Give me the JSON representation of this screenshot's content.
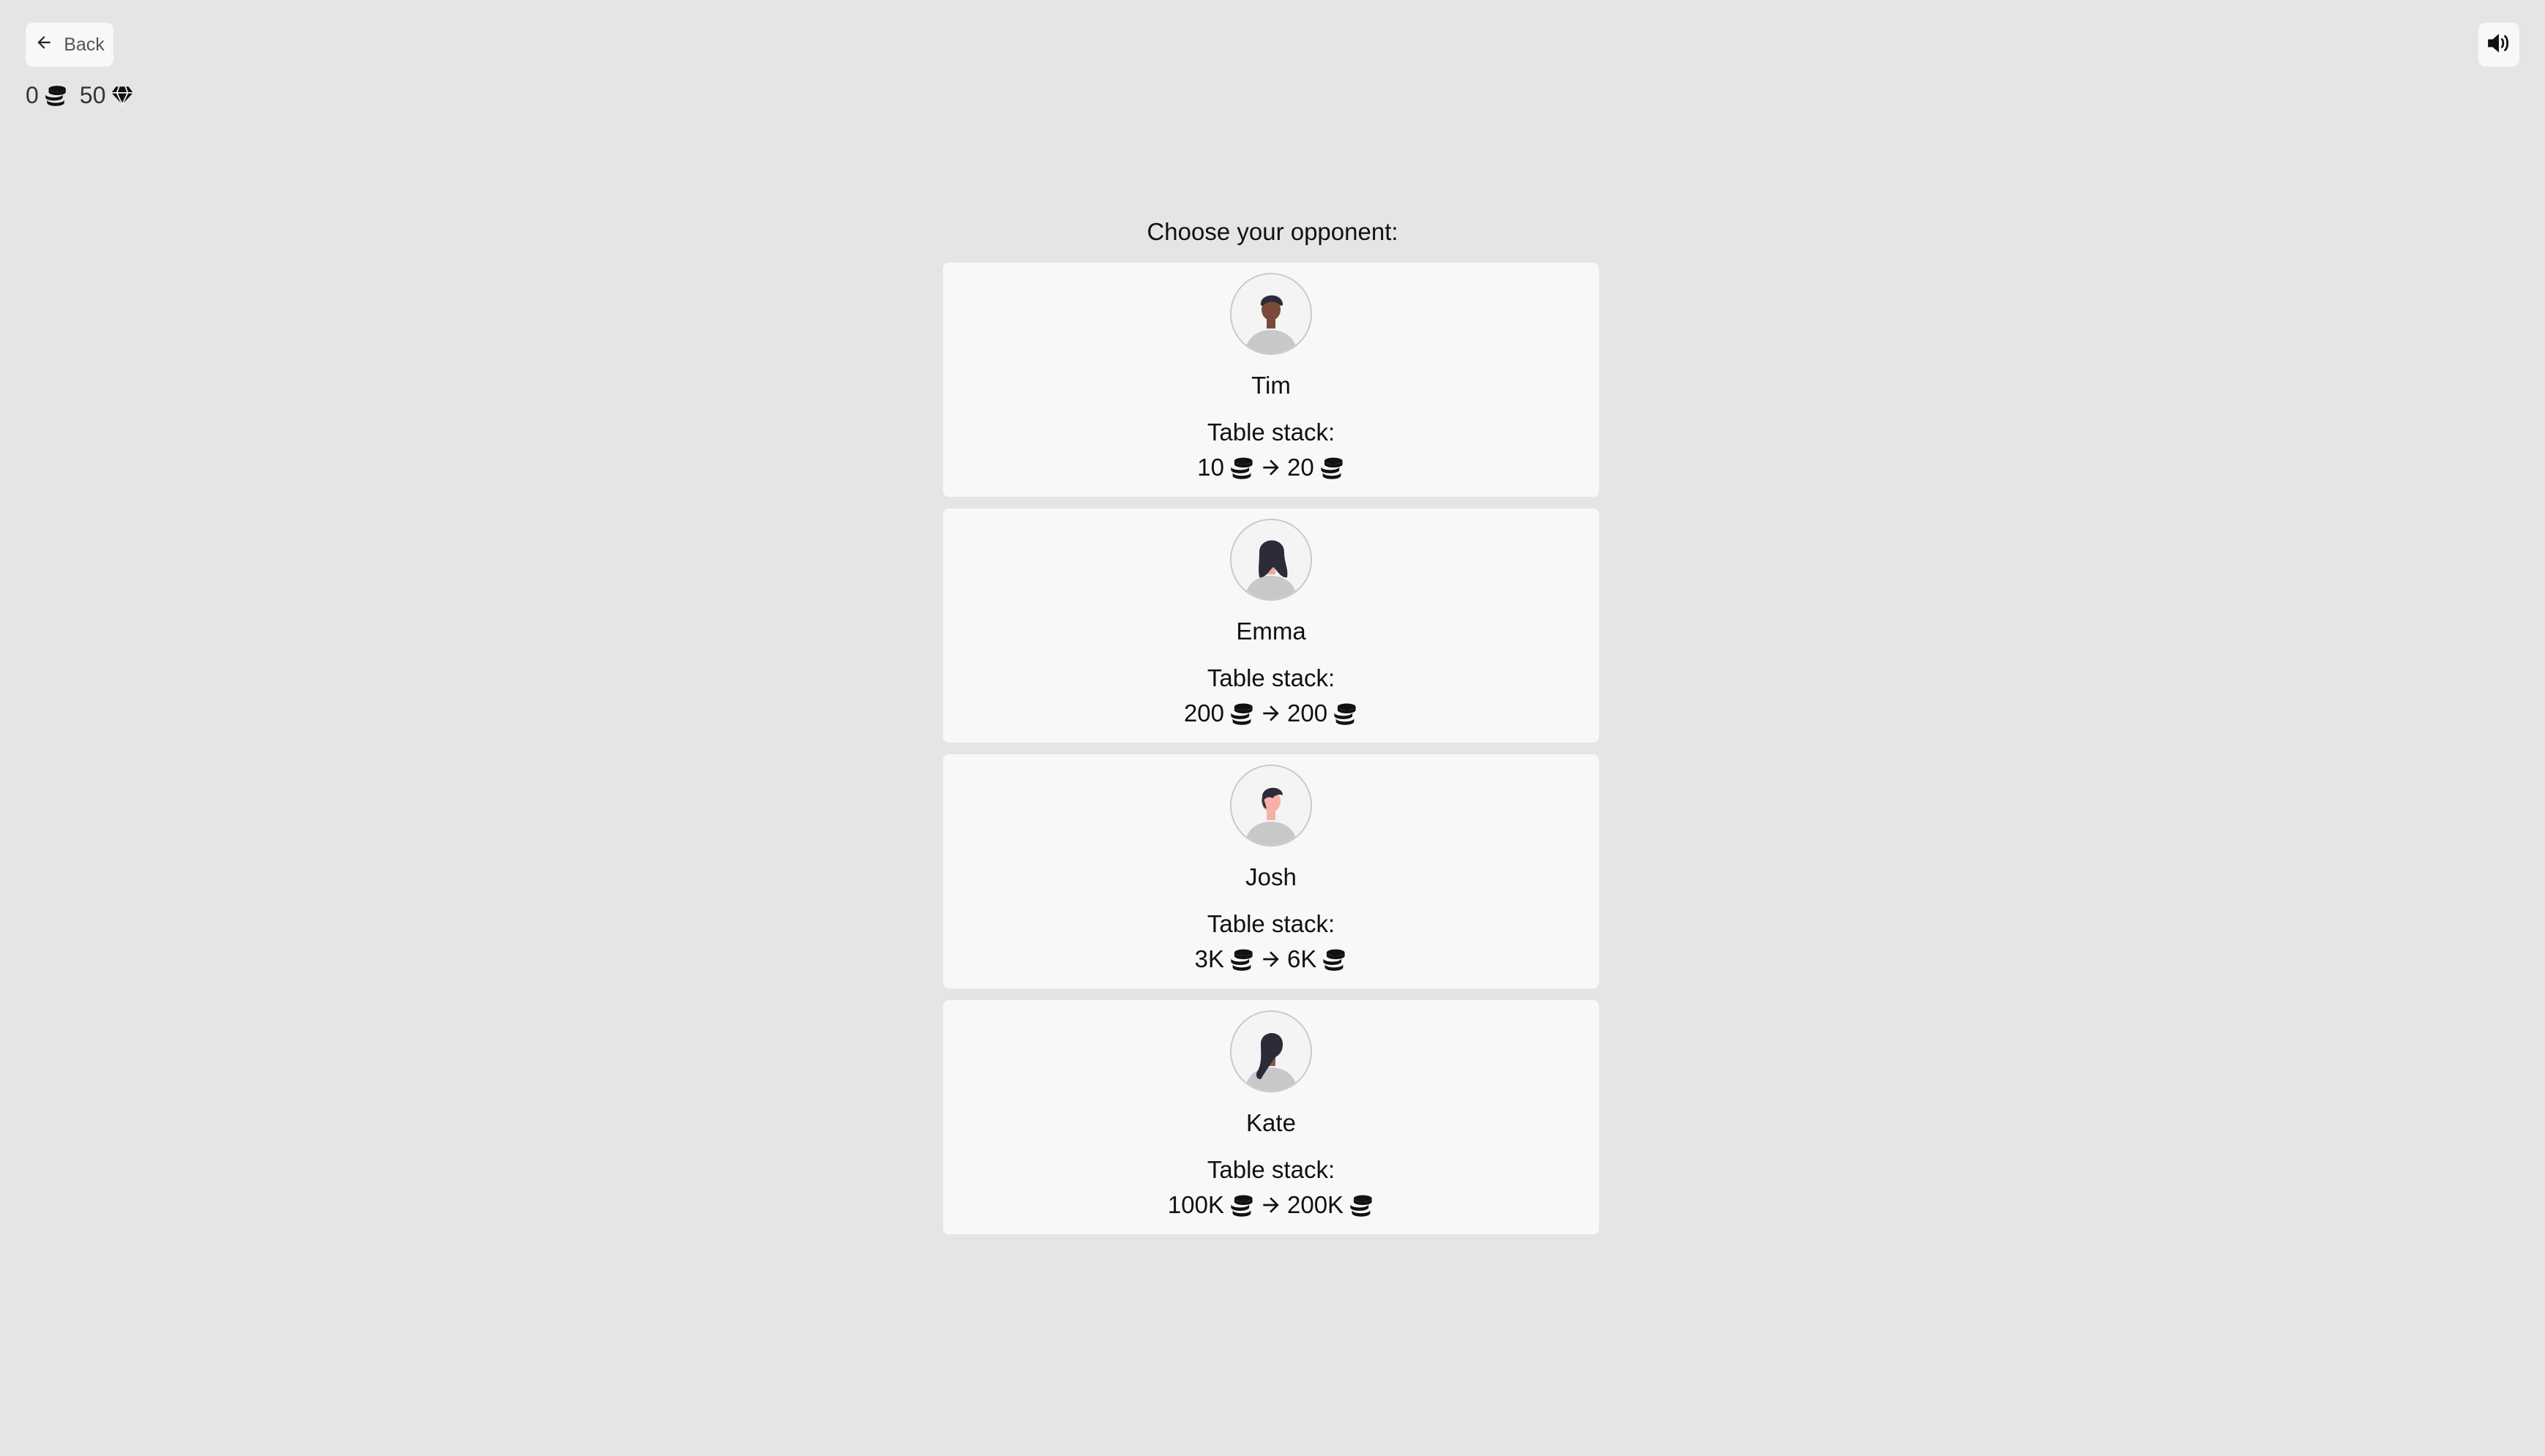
{
  "header": {
    "back_label": "Back",
    "back_icon": "arrow-left-icon",
    "sound_icon": "volume-icon"
  },
  "wallet": {
    "coins": "0",
    "coins_icon": "coins-icon",
    "gems": "50",
    "gems_icon": "gem-icon"
  },
  "title": "Choose your opponent:",
  "stack_label": "Table stack:",
  "opponents": [
    {
      "name": "Tim",
      "from": "10",
      "to": "20",
      "skin": "#7a4a3a",
      "hair": "#2b2b3a"
    },
    {
      "name": "Emma",
      "from": "200",
      "to": "200",
      "skin": "#f2a6a0",
      "hair": "#2b2b3a"
    },
    {
      "name": "Josh",
      "from": "3K",
      "to": "6K",
      "skin": "#f5b0a8",
      "hair": "#2b2b3a"
    },
    {
      "name": "Kate",
      "from": "100K",
      "to": "200K",
      "skin": "#8a5a4a",
      "hair": "#2b2b3a"
    }
  ]
}
